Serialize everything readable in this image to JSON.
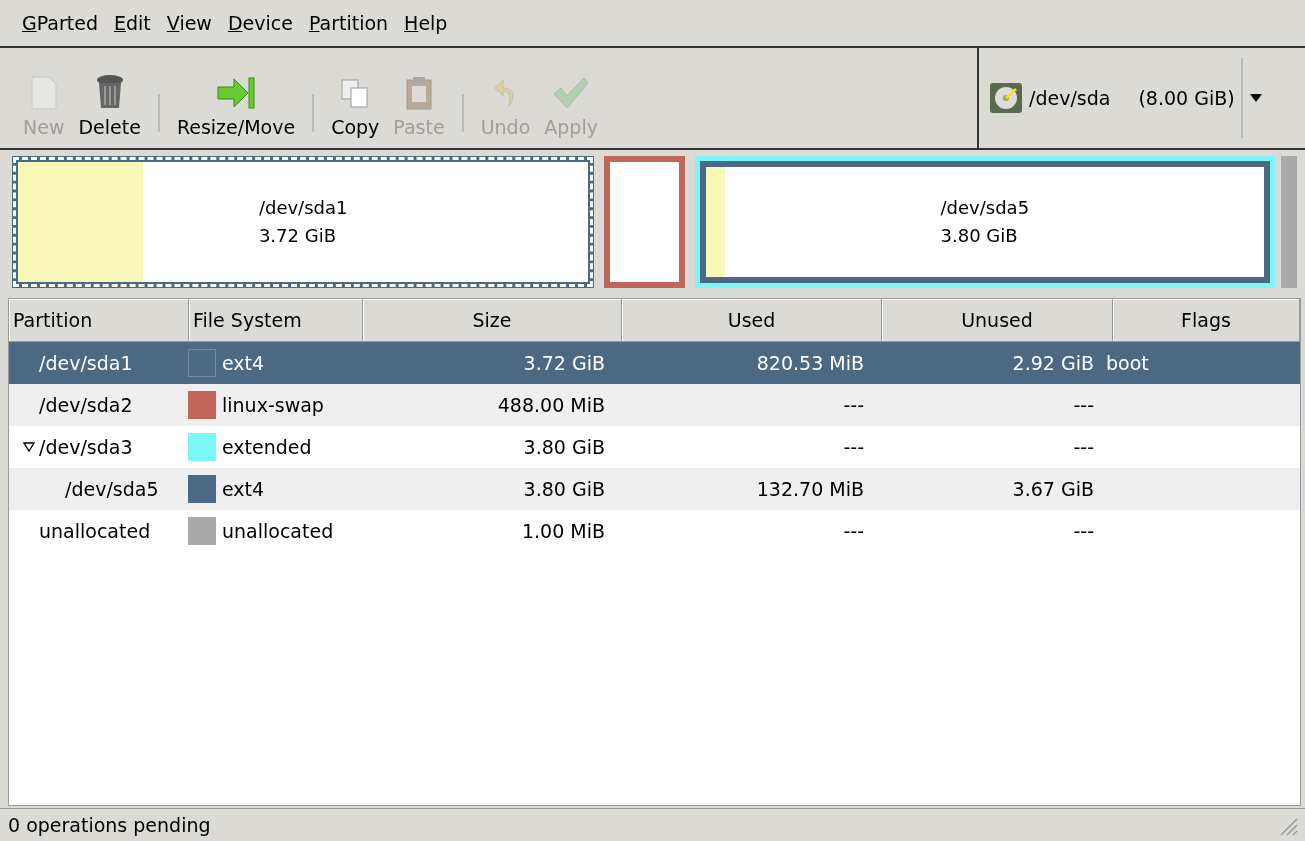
{
  "menu": [
    {
      "label": "GParted"
    },
    {
      "label": "Edit"
    },
    {
      "label": "View"
    },
    {
      "label": "Device"
    },
    {
      "label": "Partition"
    },
    {
      "label": "Help"
    }
  ],
  "toolbar": [
    {
      "kind": "new",
      "label": "New",
      "disabled": true
    },
    {
      "kind": "delete",
      "label": "Delete",
      "disabled": false
    },
    {
      "kind": "separator"
    },
    {
      "kind": "resize",
      "label": "Resize/Move",
      "disabled": false
    },
    {
      "kind": "separator"
    },
    {
      "kind": "copy",
      "label": "Copy",
      "disabled": false
    },
    {
      "kind": "paste",
      "label": "Paste",
      "disabled": true
    },
    {
      "kind": "separator"
    },
    {
      "kind": "undo",
      "label": "Undo",
      "disabled": true
    },
    {
      "kind": "apply",
      "label": "Apply",
      "disabled": true
    }
  ],
  "device": {
    "name": "/dev/sda",
    "size": "(8.00 GiB)"
  },
  "graph": [
    {
      "kind": "partition",
      "label": "/dev/sda1",
      "size": "3.72 GiB",
      "color": "#4b6983",
      "level": 0.22,
      "selected": true
    },
    {
      "kind": "partition",
      "color": "#c1665a",
      "selected": false
    },
    {
      "kind": "extended",
      "color": "#7bf7f7",
      "children": [
        {
          "kind": "partition",
          "label": "/dev/sda5",
          "size": "3.80 GiB",
          "color": "#4b6983",
          "level": 0.034,
          "selected": false
        }
      ]
    }
  ],
  "table": {
    "columns": [
      "Partition",
      "File System",
      "Size",
      "Used",
      "Unused",
      "Flags"
    ],
    "rows": [
      {
        "partition": "/dev/sda1",
        "filesystem": "ext4",
        "color": "#4b6983",
        "size": "3.72 GiB",
        "used": "820.53 MiB",
        "unused": "2.92 GiB",
        "flags": "boot",
        "selected": true
      },
      {
        "partition": "/dev/sda2",
        "filesystem": "linux-swap",
        "color": "#c1665a",
        "size": "488.00 MiB",
        "used": "---",
        "unused": "---",
        "selected": false
      },
      {
        "partition": "/dev/sda3",
        "filesystem": "extended",
        "color": "#7bf7f7",
        "size": "3.80 GiB",
        "used": "---",
        "unused": "---",
        "selected": false,
        "expanded": true,
        "children": [
          {
            "partition": "/dev/sda5",
            "filesystem": "ext4",
            "color": "#4b6983",
            "size": "3.80 GiB",
            "used": "132.70 MiB",
            "unused": "3.67 GiB",
            "selected": false
          }
        ]
      },
      {
        "partition": "unallocated",
        "filesystem": "unallocated",
        "color": "#a9a9a9",
        "size": "1.00 MiB",
        "used": "---",
        "unused": "---",
        "selected": false
      }
    ]
  },
  "status_bar": "0 operations pending"
}
